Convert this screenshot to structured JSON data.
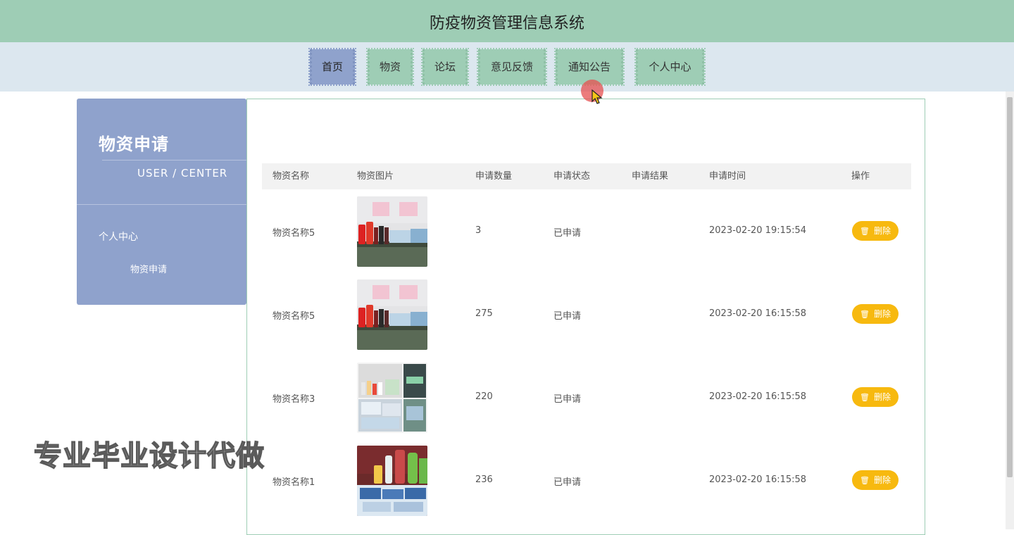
{
  "header": {
    "title": "防疫物资管理信息系统"
  },
  "nav": {
    "items": [
      {
        "label": "首页",
        "active": true
      },
      {
        "label": "物资",
        "active": false
      },
      {
        "label": "论坛",
        "active": false
      },
      {
        "label": "意见反馈",
        "active": false
      },
      {
        "label": "通知公告",
        "active": false
      },
      {
        "label": "个人中心",
        "active": false
      }
    ]
  },
  "sidebar": {
    "title": "物资申请",
    "subtitle": "USER / CENTER",
    "items": [
      "个人中心",
      "物资申请"
    ]
  },
  "table": {
    "headers": [
      "物资名称",
      "物资图片",
      "申请数量",
      "申请状态",
      "申请结果",
      "申请时间",
      "操作"
    ],
    "rows": [
      {
        "name": "物资名称5",
        "image": "supplies-photo-sprayers",
        "quantity": "3",
        "status": "已申请",
        "result": "",
        "time": "2023-02-20 19:15:54",
        "action": "删除"
      },
      {
        "name": "物资名称5",
        "image": "supplies-photo-sprayers",
        "quantity": "275",
        "status": "已申请",
        "result": "",
        "time": "2023-02-20 16:15:58",
        "action": "删除"
      },
      {
        "name": "物资名称3",
        "image": "supplies-photo-boxes",
        "quantity": "220",
        "status": "已申请",
        "result": "",
        "time": "2023-02-20 16:15:58",
        "action": "删除"
      },
      {
        "name": "物资名称1",
        "image": "supplies-photo-sanitizer",
        "quantity": "236",
        "status": "已申请",
        "result": "",
        "time": "2023-02-20 16:15:58",
        "action": "删除"
      }
    ]
  },
  "watermark": "专业毕业设计代做",
  "colors": {
    "header_bg": "#9ecdb5",
    "nav_bg": "#dce7ef",
    "nav_active": "#8fa2cc",
    "sidebar_bg": "#8fa2cc",
    "delete_button": "#f7b90f"
  }
}
